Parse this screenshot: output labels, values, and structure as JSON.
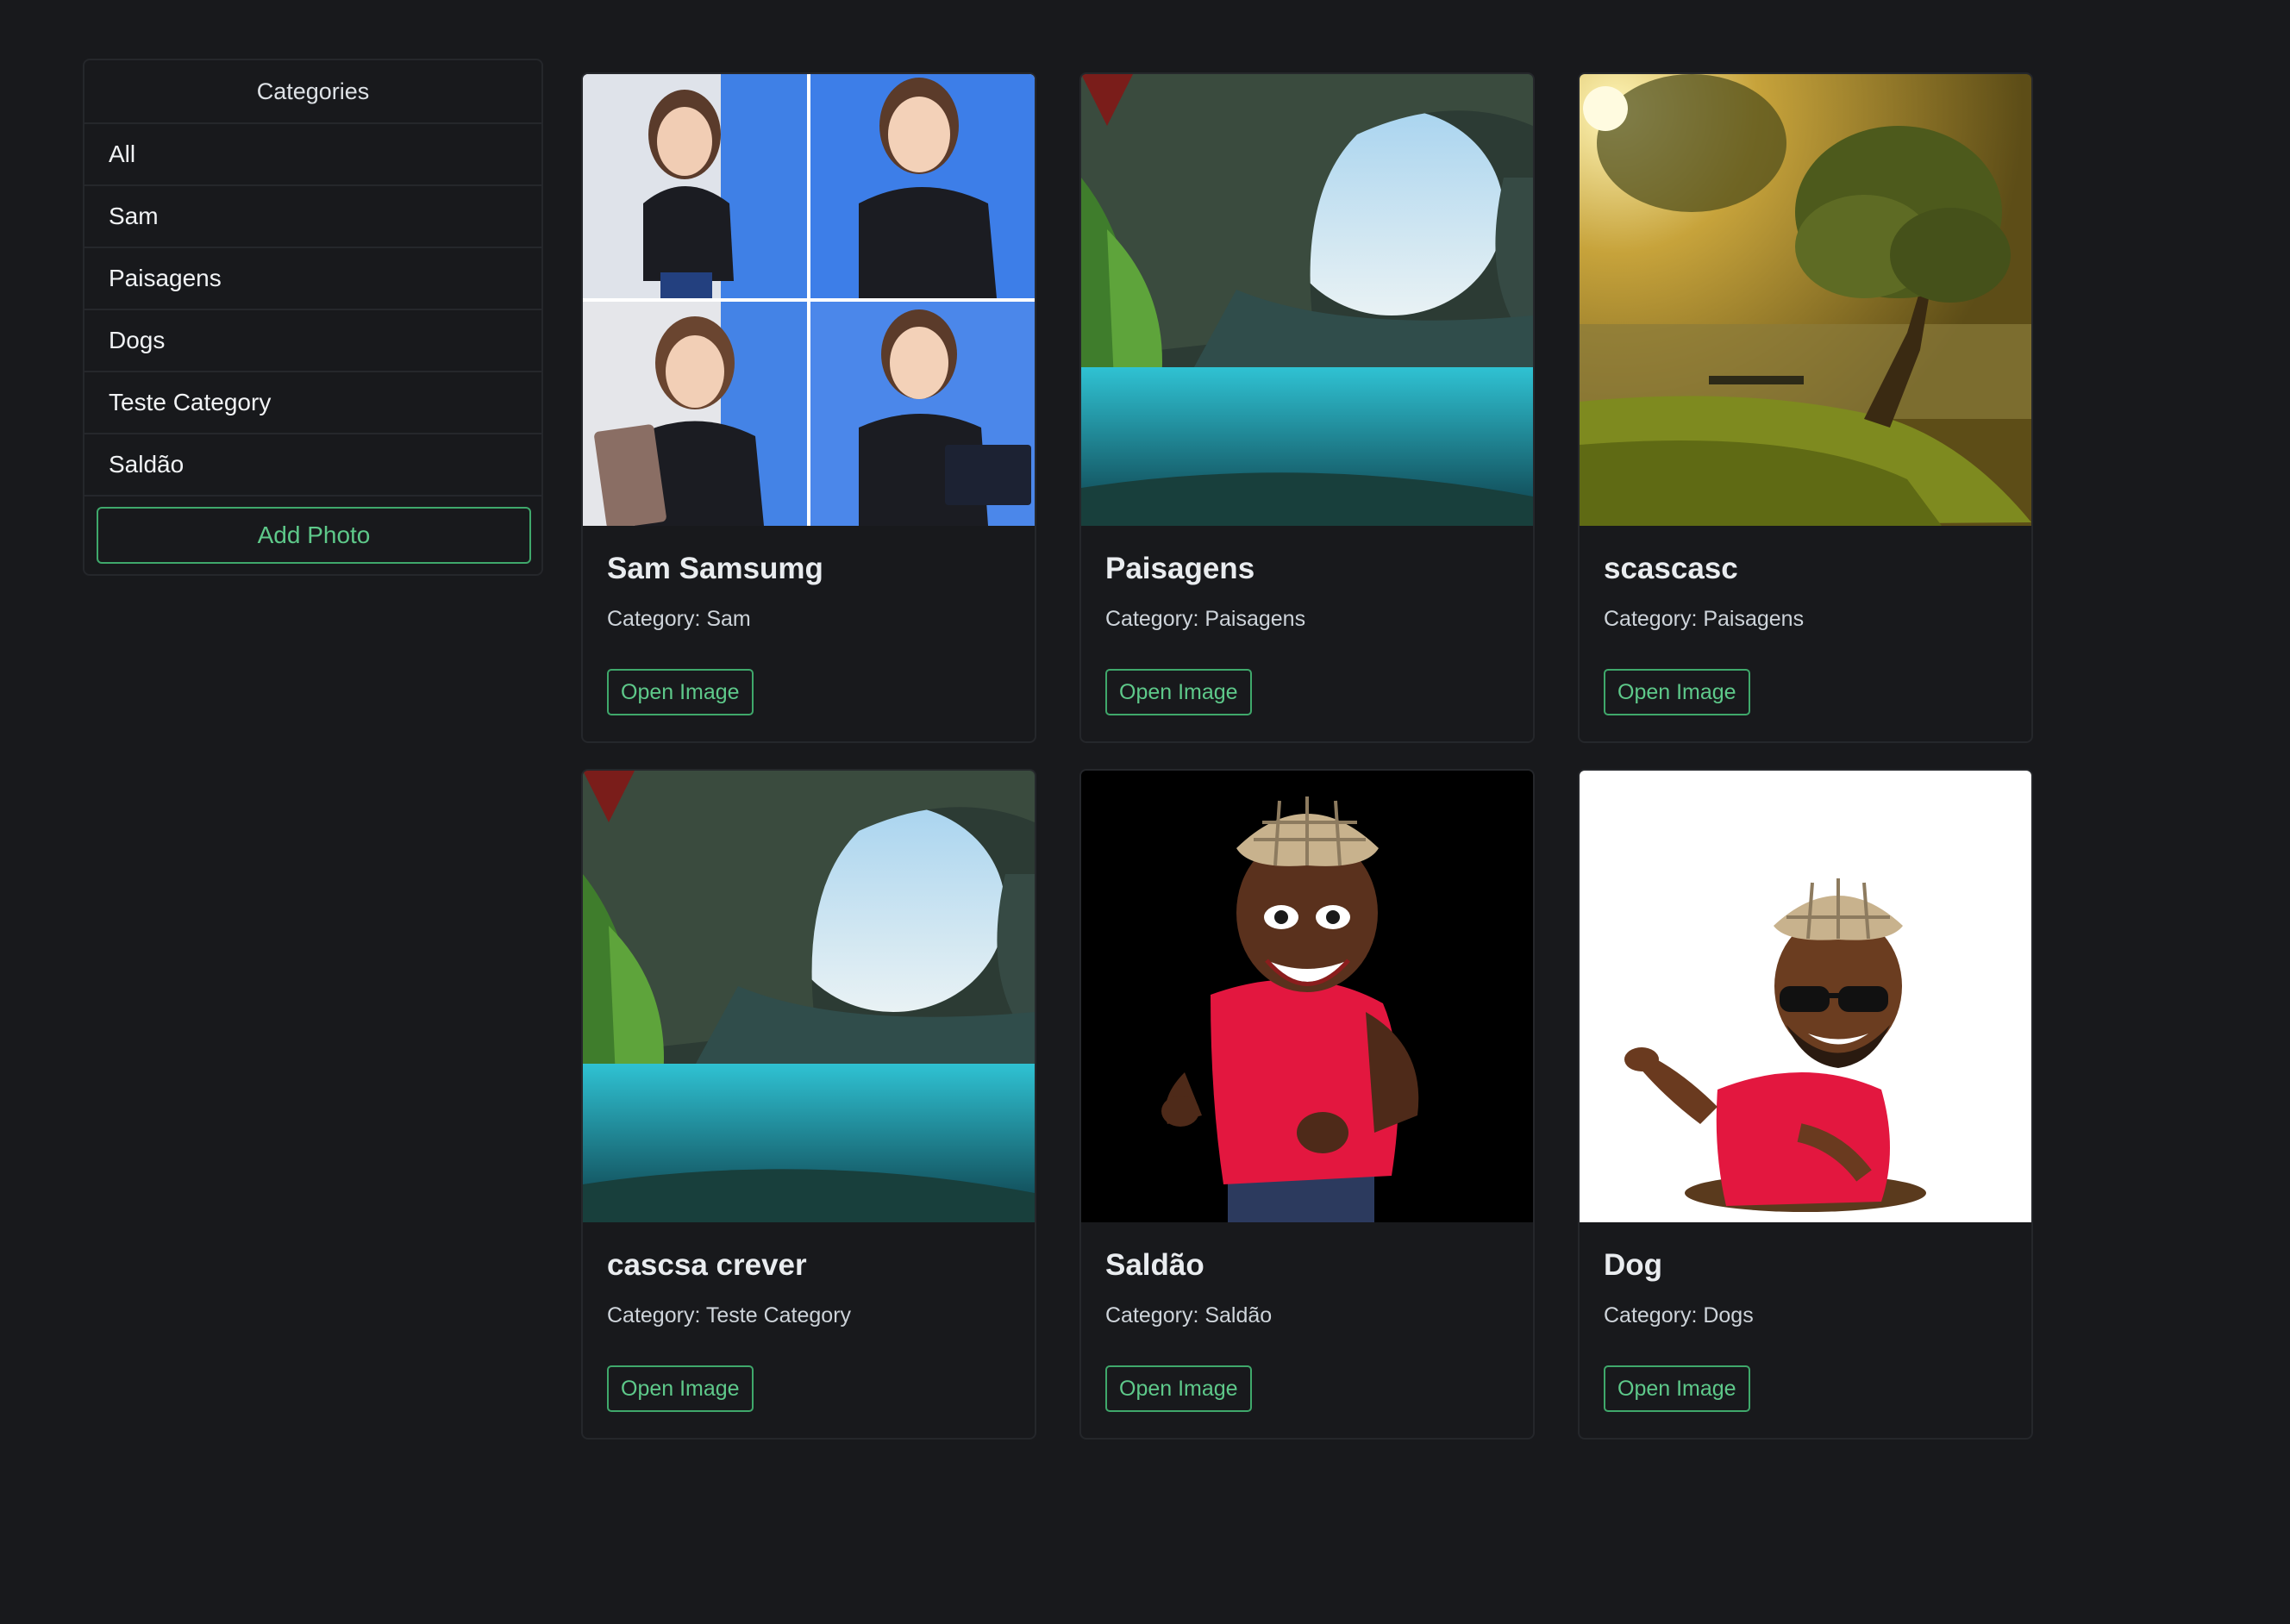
{
  "sidebar": {
    "header": "Categories",
    "items": [
      {
        "label": "All"
      },
      {
        "label": "Sam"
      },
      {
        "label": "Paisagens"
      },
      {
        "label": "Dogs"
      },
      {
        "label": "Teste Category"
      },
      {
        "label": "Saldão"
      }
    ],
    "add_photo_label": "Add Photo"
  },
  "cards": [
    {
      "title": "Sam Samsumg",
      "category": "Category: Sam",
      "button": "Open Image",
      "image": "avatar-collage"
    },
    {
      "title": "Paisagens",
      "category": "Category: Paisagens",
      "button": "Open Image",
      "image": "cave-lagoon"
    },
    {
      "title": "scascasc",
      "category": "Category: Paisagens",
      "button": "Open Image",
      "image": "tree-lake-sunset"
    },
    {
      "title": "cascsa crever",
      "category": "Category: Teste Category",
      "button": "Open Image",
      "image": "cave-lagoon"
    },
    {
      "title": "Saldão",
      "category": "Category: Saldão",
      "button": "Open Image",
      "image": "cartoon-man-thumbs-up"
    },
    {
      "title": "Dog",
      "category": "Category: Dogs",
      "button": "Open Image",
      "image": "cartoon-man-pointing"
    }
  ],
  "colors": {
    "background": "#18191c",
    "border": "#25272b",
    "accent": "#5ec98a",
    "text": "#dee2e6"
  }
}
